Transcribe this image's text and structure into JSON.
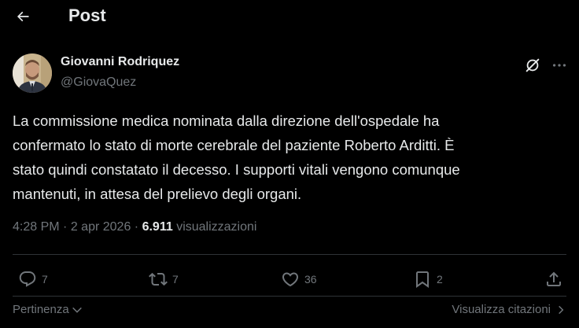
{
  "header": {
    "title": "Post",
    "back_icon": "arrow-left-icon"
  },
  "author": {
    "name": "Giovanni Rodriquez",
    "handle": "@GiovaQuez"
  },
  "post": {
    "text": "La commissione medica nominata dalla direzione dell'ospedale ha\nconfermato lo stato di morte cerebrale del paziente Roberto Arditti. È\nstato quindi constatato il decesso. I supporti vitali vengono comunque\nmantenuti, in attesa del prelievo degli organi.",
    "time": "4:28 PM",
    "separator": "·",
    "date": "2 apr 2026",
    "views_count": "6.911",
    "views_label": "visualizzazioni"
  },
  "actions": {
    "replies": "7",
    "reposts": "7",
    "likes": "36",
    "bookmarks": "2"
  },
  "footer": {
    "sort_label": "Pertinenza",
    "quotes_label": "Visualizza citazioni"
  },
  "colors": {
    "background": "#000000",
    "text": "#e7e9ea",
    "secondary": "#71767b",
    "divider": "#2f3336"
  }
}
